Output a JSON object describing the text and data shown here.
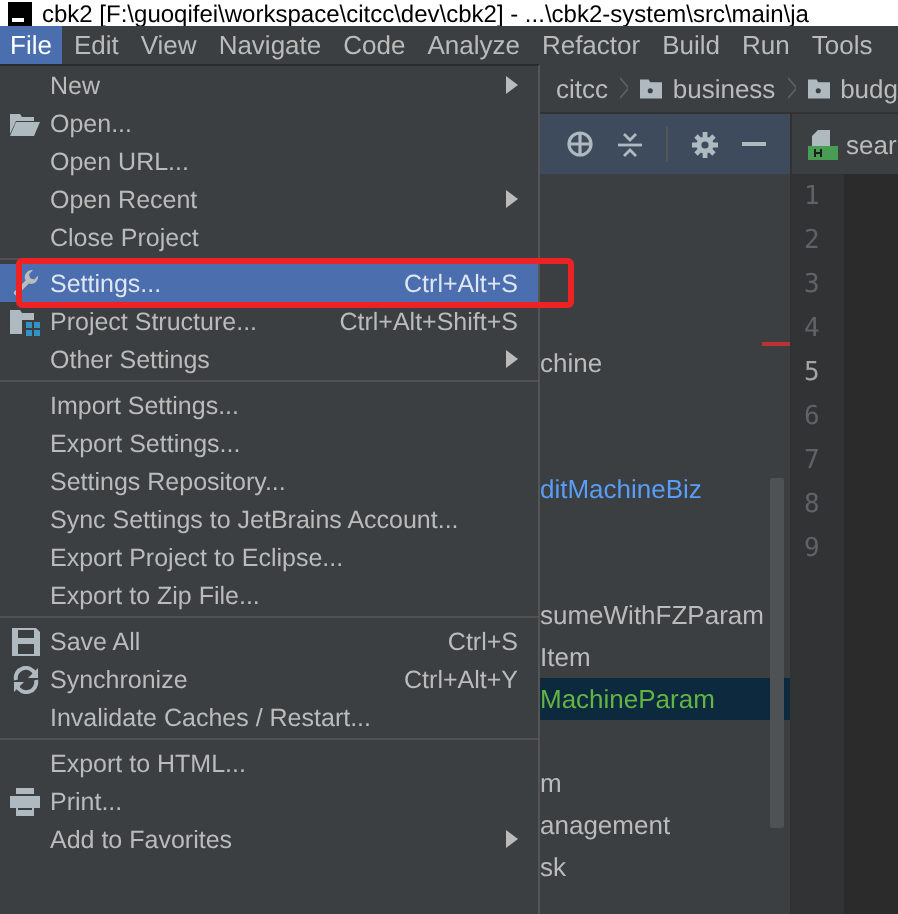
{
  "window": {
    "title": "cbk2 [F:\\guoqifei\\workspace\\citcc\\dev\\cbk2] - ...\\cbk2-system\\src\\main\\ja"
  },
  "menubar": [
    {
      "label": "File",
      "selected": true
    },
    {
      "label": "Edit",
      "selected": false
    },
    {
      "label": "View",
      "selected": false
    },
    {
      "label": "Navigate",
      "selected": false
    },
    {
      "label": "Code",
      "selected": false
    },
    {
      "label": "Analyze",
      "selected": false
    },
    {
      "label": "Refactor",
      "selected": false
    },
    {
      "label": "Build",
      "selected": false
    },
    {
      "label": "Run",
      "selected": false
    },
    {
      "label": "Tools",
      "selected": false
    }
  ],
  "file_menu": {
    "sections": [
      [
        {
          "label": "New",
          "submenu": true,
          "selected": false,
          "annotated": false
        },
        {
          "label": "Open...",
          "submenu": false,
          "selected": false,
          "annotated": false
        },
        {
          "label": "Open URL...",
          "submenu": false,
          "selected": false,
          "annotated": false
        },
        {
          "label": "Open Recent",
          "submenu": true,
          "selected": false,
          "annotated": false
        },
        {
          "label": "Close Project",
          "submenu": false,
          "selected": false,
          "annotated": false
        }
      ],
      [
        {
          "label": "Settings...",
          "shortcut": "Ctrl+Alt+S",
          "submenu": false,
          "selected": true,
          "annotated": true
        },
        {
          "label": "Project Structure...",
          "shortcut": "Ctrl+Alt+Shift+S",
          "submenu": false,
          "selected": false,
          "annotated": false
        },
        {
          "label": "Other Settings",
          "submenu": true,
          "selected": false,
          "annotated": false
        }
      ],
      [
        {
          "label": "Import Settings...",
          "submenu": false,
          "selected": false,
          "annotated": false
        },
        {
          "label": "Export Settings...",
          "submenu": false,
          "selected": false,
          "annotated": false
        },
        {
          "label": "Settings Repository...",
          "submenu": false,
          "selected": false,
          "annotated": false
        },
        {
          "label": "Sync Settings to JetBrains Account...",
          "submenu": false,
          "selected": false,
          "annotated": false
        },
        {
          "label": "Export Project to Eclipse...",
          "submenu": false,
          "selected": false,
          "annotated": false
        },
        {
          "label": "Export to Zip File...",
          "submenu": false,
          "selected": false,
          "annotated": false
        }
      ],
      [
        {
          "label": "Save All",
          "shortcut": "Ctrl+S",
          "submenu": false,
          "selected": false,
          "annotated": false
        },
        {
          "label": "Synchronize",
          "shortcut": "Ctrl+Alt+Y",
          "submenu": false,
          "selected": false,
          "annotated": false
        },
        {
          "label": "Invalidate Caches / Restart...",
          "submenu": false,
          "selected": false,
          "annotated": false
        }
      ],
      [
        {
          "label": "Export to HTML...",
          "submenu": false,
          "selected": false,
          "annotated": false
        },
        {
          "label": "Print...",
          "submenu": false,
          "selected": false,
          "annotated": false
        },
        {
          "label": "Add to Favorites",
          "submenu": true,
          "selected": false,
          "annotated": false
        }
      ]
    ]
  },
  "breadcrumbs": [
    "citcc",
    "business",
    "budg"
  ],
  "editor_tab": {
    "label": "sear"
  },
  "project_tree": [
    {
      "label": "chine",
      "color": "#bbbbbb",
      "selected": false
    },
    {
      "label": "ditMachineBiz",
      "color": "#589df6",
      "selected": false
    },
    {
      "label": "sumeWithFZParam",
      "color": "#bbbbbb",
      "selected": false
    },
    {
      "label": "Item",
      "color": "#bbbbbb",
      "selected": false
    },
    {
      "label": "MachineParam",
      "color": "#62b543",
      "selected": true
    },
    {
      "label": "m",
      "color": "#bbbbbb",
      "selected": false
    },
    {
      "label": "anagement",
      "color": "#bbbbbb",
      "selected": false
    },
    {
      "label": "sk",
      "color": "#bbbbbb",
      "selected": false
    }
  ],
  "line_numbers": [
    {
      "label": "1",
      "current": false
    },
    {
      "label": "2",
      "current": false
    },
    {
      "label": "3",
      "current": false
    },
    {
      "label": "4",
      "current": false
    },
    {
      "label": "5",
      "current": true
    },
    {
      "label": "6",
      "current": false
    },
    {
      "label": "7",
      "current": false
    },
    {
      "label": "8",
      "current": false
    },
    {
      "label": "9",
      "current": false
    }
  ]
}
